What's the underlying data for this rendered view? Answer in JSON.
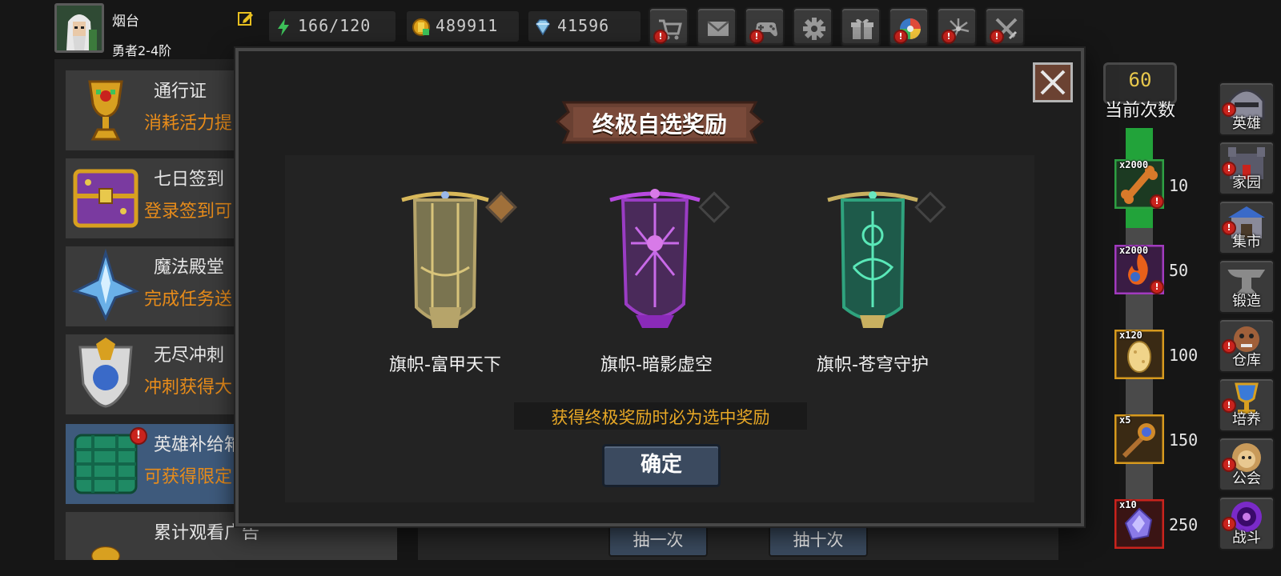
{
  "player": {
    "name": "烟台",
    "rank": "勇者2-4阶"
  },
  "resources": {
    "energy": "166/120",
    "gold": "489911",
    "gems": "41596"
  },
  "top_buttons": [
    {
      "name": "shop",
      "alert": "!"
    },
    {
      "name": "mail",
      "alert": ""
    },
    {
      "name": "gamepad",
      "alert": "!"
    },
    {
      "name": "settings",
      "alert": ""
    },
    {
      "name": "gift",
      "alert": ""
    },
    {
      "name": "wheel",
      "alert": "!"
    },
    {
      "name": "fireworks",
      "alert": "!"
    },
    {
      "name": "battle",
      "alert": "!"
    }
  ],
  "features": [
    {
      "title": "通行证",
      "desc": "消耗活力提"
    },
    {
      "title": "七日签到",
      "desc": "登录签到可"
    },
    {
      "title": "魔法殿堂",
      "desc": "完成任务送"
    },
    {
      "title": "无尽冲刺",
      "desc": "冲刺获得大"
    },
    {
      "title": "英雄补给箱",
      "desc": "可获得限定"
    },
    {
      "title": "累计观看广告",
      "desc": ""
    }
  ],
  "draw": {
    "once": "抽一次",
    "ten": "抽十次"
  },
  "progress": {
    "count": "60",
    "count_label": "当前次数",
    "fill_fraction": 0.24,
    "milestones": [
      {
        "qty": "x2000",
        "threshold": "10",
        "color": "#2ea043"
      },
      {
        "qty": "x2000",
        "threshold": "50",
        "color": "#a23bbf"
      },
      {
        "qty": "x120",
        "threshold": "100",
        "color": "#d79a1e"
      },
      {
        "qty": "x5",
        "threshold": "150",
        "color": "#d79a1e"
      },
      {
        "qty": "x10",
        "threshold": "250",
        "color": "#c9231d"
      }
    ]
  },
  "nav": [
    "英雄",
    "家园",
    "集市",
    "锻造",
    "仓库",
    "培养",
    "公会",
    "战斗"
  ],
  "modal": {
    "title": "终极自选奖励",
    "rewards": [
      {
        "name": "旗帜-富甲天下",
        "color": "#b6a46a"
      },
      {
        "name": "旗帜-暗影虚空",
        "color": "#9a3cc4"
      },
      {
        "name": "旗帜-苍穹守护",
        "color": "#2fa37e"
      }
    ],
    "hint": "获得终极奖励时必为选中奖励",
    "confirm": "确定"
  }
}
